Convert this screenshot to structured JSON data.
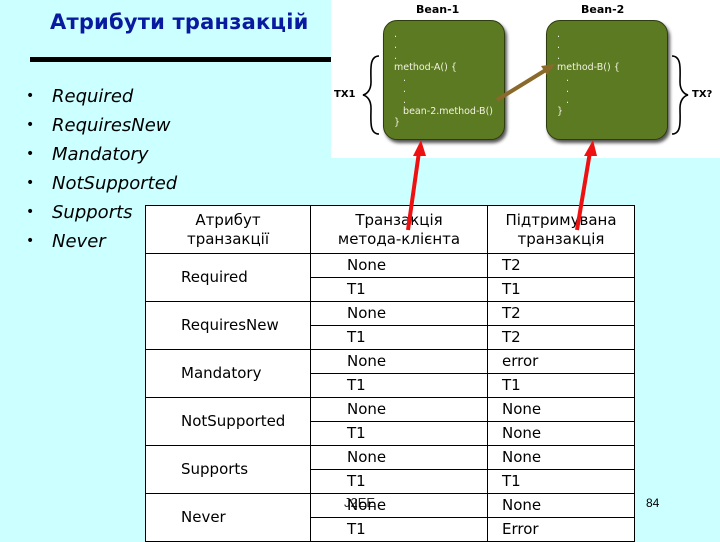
{
  "slide": {
    "title": "Атрибути транзакцій",
    "page_number": "84",
    "footer_tag": "J2EE",
    "colors": {
      "background": "#ccffff",
      "title": "#0a1aa0",
      "bean_fill": "#5c7a22",
      "arrow_red": "#ee1111",
      "call_arrow": "#8a6a2a"
    }
  },
  "bullets": [
    {
      "marker": "•",
      "label": "Required"
    },
    {
      "marker": "•",
      "label": "RequiresNew"
    },
    {
      "marker": "•",
      "label": "Mandatory"
    },
    {
      "marker": "•",
      "label": "NotSupported"
    },
    {
      "marker": "•",
      "label": "Supports"
    },
    {
      "marker": "•",
      "label": "Never"
    }
  ],
  "diagram": {
    "bean1": {
      "label": "Bean-1",
      "code": ".\n.\n.\nmethod-A() {\n   .\n   .\n   .\n   bean-2.method-B()\n}"
    },
    "bean2": {
      "label": "Bean-2",
      "code": ".\n.\n.\nmethod-B() {\n   .\n   .\n   .\n}"
    },
    "tx_left": "TX1",
    "tx_right": "TX?"
  },
  "table": {
    "headers": [
      "Атрибут транзакції",
      "Транзакція метода-клієнта",
      "Підтримувана транзакція"
    ],
    "header_lines": [
      [
        "Атрибут",
        "транзакції"
      ],
      [
        "Транзакція",
        "метода-клієнта"
      ],
      [
        "Підтримувана",
        "транзакція"
      ]
    ],
    "rows": [
      {
        "attribute": "Required",
        "cases": [
          {
            "client": "None",
            "supported": "T2"
          },
          {
            "client": "T1",
            "supported": "T1"
          }
        ]
      },
      {
        "attribute": "RequiresNew",
        "cases": [
          {
            "client": "None",
            "supported": "T2"
          },
          {
            "client": "T1",
            "supported": "T2"
          }
        ]
      },
      {
        "attribute": "Mandatory",
        "cases": [
          {
            "client": "None",
            "supported": "error"
          },
          {
            "client": "T1",
            "supported": "T1"
          }
        ]
      },
      {
        "attribute": "NotSupported",
        "cases": [
          {
            "client": "None",
            "supported": "None"
          },
          {
            "client": "T1",
            "supported": "None"
          }
        ]
      },
      {
        "attribute": "Supports",
        "cases": [
          {
            "client": "None",
            "supported": "None"
          },
          {
            "client": "T1",
            "supported": "T1"
          }
        ]
      },
      {
        "attribute": "Never",
        "cases": [
          {
            "client": "None",
            "supported": "None"
          },
          {
            "client": "T1",
            "supported": "Error"
          }
        ]
      }
    ]
  }
}
